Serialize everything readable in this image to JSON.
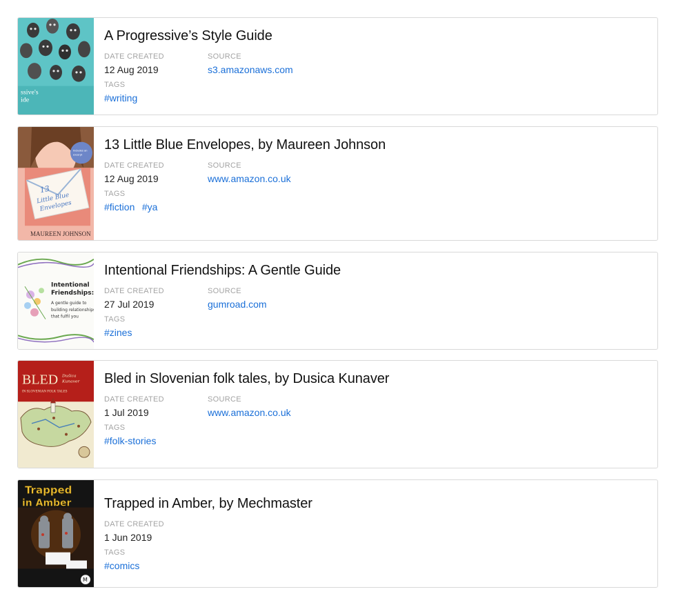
{
  "labels": {
    "date_created": "DATE CREATED",
    "source": "SOURCE",
    "tags": "TAGS"
  },
  "colors": {
    "link": "#1a6fd8",
    "label": "#a3a3a3",
    "border": "#d9d9d9"
  },
  "items": [
    {
      "title": "A Progressive’s Style Guide",
      "date": "12 Aug 2019",
      "source": "s3.amazonaws.com",
      "tags": [
        "#writing"
      ],
      "cover": {
        "icon": "book-cover-faces-image",
        "text_line1": "ssive's",
        "text_line2": "ide"
      }
    },
    {
      "title": "13 Little Blue Envelopes, by Maureen Johnson",
      "date": "12 Aug 2019",
      "source": "www.amazon.co.uk",
      "tags": [
        "#fiction",
        "#ya"
      ],
      "cover": {
        "icon": "book-cover-envelope-image",
        "author": "MAUREEN JOHNSON",
        "envelope_text": "13 Little Blue Envelopes"
      }
    },
    {
      "title": "Intentional Friendships: A Gentle Guide",
      "date": "27 Jul 2019",
      "source": "gumroad.com",
      "tags": [
        "#zines"
      ],
      "cover": {
        "icon": "zine-cover-flowers-image",
        "line1": "Intentional",
        "line2": "Friendships:"
      }
    },
    {
      "title": "Bled in Slovenian folk tales, by Dusica Kunaver",
      "date": "1 Jul 2019",
      "source": "www.amazon.co.uk",
      "tags": [
        "#folk-stories"
      ],
      "cover": {
        "icon": "book-cover-map-image",
        "big": "BLED",
        "small": "IN SLOVENIAN FOLK TALES"
      }
    },
    {
      "title": "Trapped in Amber, by Mechmaster",
      "date": "1 Jun 2019",
      "source": null,
      "tags": [
        "#comics"
      ],
      "cover": {
        "icon": "comic-cover-robots-image",
        "line1": "Trapped",
        "line2": "in Amber"
      }
    }
  ]
}
